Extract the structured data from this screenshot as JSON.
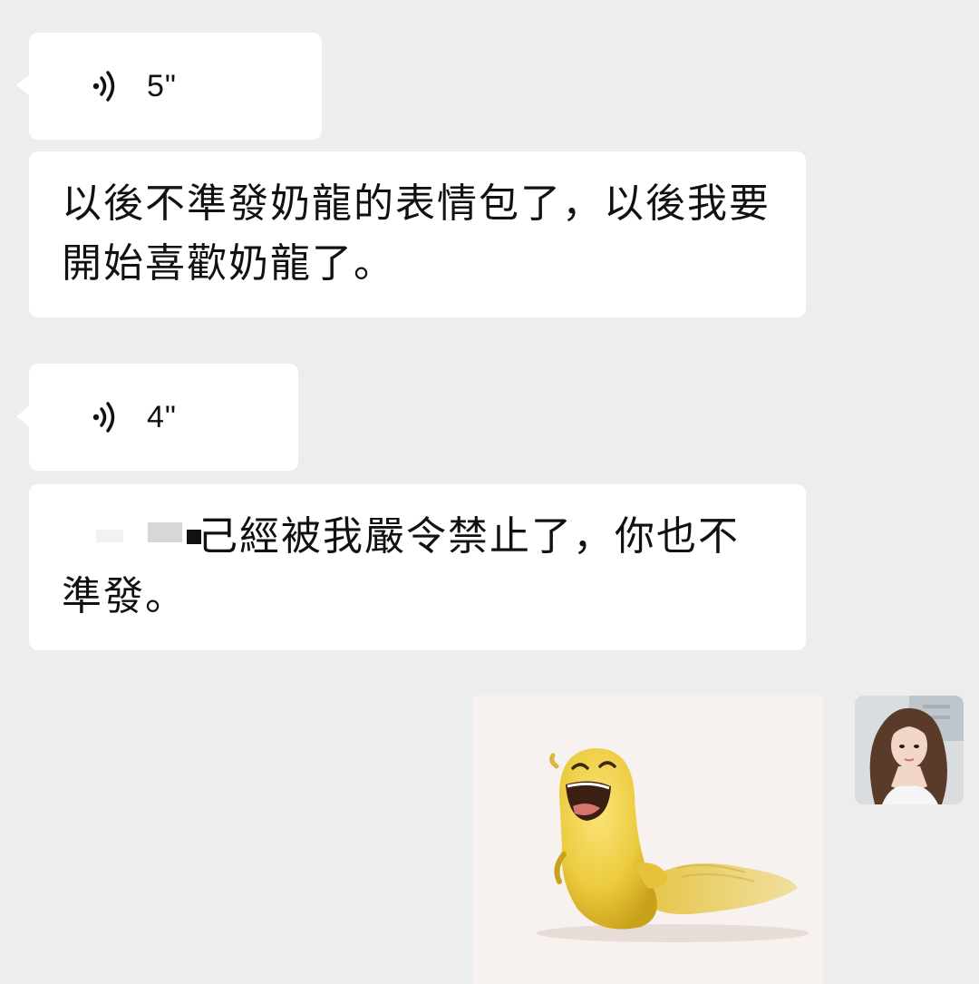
{
  "messages": [
    {
      "type": "voice",
      "duration": "5\"",
      "icon": "voice-wave-icon"
    },
    {
      "type": "text",
      "text": "以後不準發奶龍的表情包了，以後我要開始喜歡奶龍了。"
    },
    {
      "type": "voice",
      "duration": "4\"",
      "icon": "voice-wave-icon"
    },
    {
      "type": "text",
      "text": "己經被我嚴令禁止了，你也不準發。"
    },
    {
      "type": "sticker",
      "icon": "yellow-slug-sticker"
    }
  ],
  "avatar": {
    "icon": "user-avatar-photo"
  },
  "colors": {
    "background": "#ededed",
    "bubble": "#ffffff",
    "text": "#111111",
    "sticker_yellow": "#f2d24a"
  }
}
